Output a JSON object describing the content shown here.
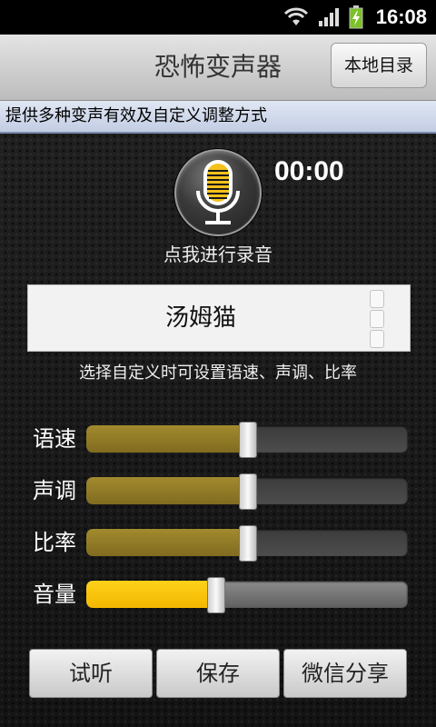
{
  "status_bar": {
    "time": "16:08",
    "icons": [
      "wifi-icon",
      "signal-icon",
      "battery-charging-icon"
    ]
  },
  "header": {
    "title": "恐怖变声器",
    "local_dir_label": "本地目录"
  },
  "info_banner": "提供多种变声有效及自定义调整方式",
  "recorder": {
    "icon": "microphone-icon",
    "timer": "00:00",
    "label": "点我进行录音"
  },
  "voice_selector": {
    "selected": "汤姆猫",
    "hint": "选择自定义时可设置语速、声调、比率"
  },
  "sliders": [
    {
      "label": "语速",
      "value_percent": 50,
      "style": "gold"
    },
    {
      "label": "声调",
      "value_percent": 50,
      "style": "gold"
    },
    {
      "label": "比率",
      "value_percent": 50,
      "style": "gold"
    },
    {
      "label": "音量",
      "value_percent": 40,
      "style": "bright"
    }
  ],
  "bottom_buttons": {
    "listen": "试听",
    "save": "保存",
    "wechat_share": "微信分享"
  },
  "colors": {
    "slider_gold": "#a28a2e",
    "slider_bright": "#ffd21a",
    "mic_yellow": "#f5c21b"
  }
}
